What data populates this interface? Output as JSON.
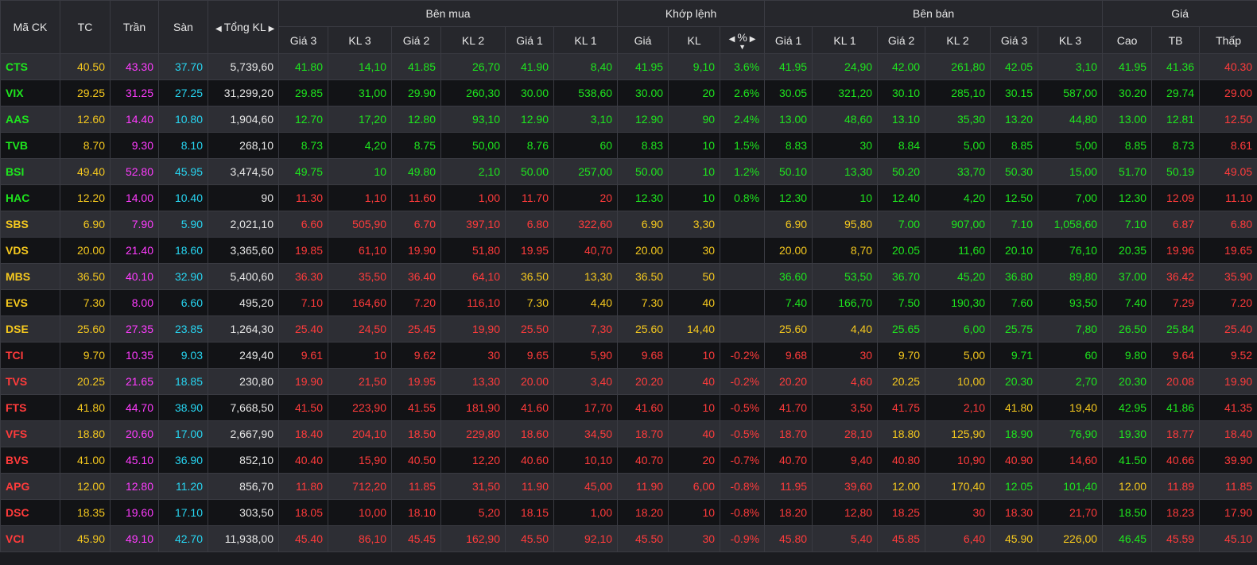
{
  "colors": {
    "up": "#1ee61e",
    "down": "#ff3b3b",
    "ref": "#f5c81e",
    "ceil": "#ff3cff",
    "floor": "#27d6f2",
    "white": "#e6e6e6"
  },
  "icons": {
    "left": "caret-left-icon",
    "right": "caret-right-icon",
    "sort": "sort-down-icon"
  },
  "header": {
    "symbol": "Mã CK",
    "ref": "TC",
    "ceil": "Trần",
    "floor": "Sàn",
    "total": "Tổng KL",
    "buy": "Bên mua",
    "match": "Khớp lệnh",
    "sell": "Bên bán",
    "price": "Giá",
    "buy_cols": [
      "Giá 3",
      "KL 3",
      "Giá 2",
      "KL 2",
      "Giá 1",
      "KL 1"
    ],
    "match_cols": [
      "Giá",
      "KL",
      "%"
    ],
    "sell_cols": [
      "Giá 1",
      "KL 1",
      "Giá 2",
      "KL 2",
      "Giá 3",
      "KL 3"
    ],
    "price_cols": [
      "Cao",
      "TB",
      "Thấp"
    ]
  },
  "rows": [
    {
      "sym": "CTS",
      "tc": "40.50",
      "tran": "43.30",
      "san": "37.70",
      "tkl": "5,739,60",
      "buy": [
        [
          "41.80",
          "14,10",
          "up"
        ],
        [
          "41.85",
          "26,70",
          "up"
        ],
        [
          "41.90",
          "8,40",
          "up"
        ]
      ],
      "match": [
        "41.95",
        "9,10",
        "3.6%",
        "up"
      ],
      "sell": [
        [
          "41.95",
          "24,90",
          "up"
        ],
        [
          "42.00",
          "261,80",
          "up"
        ],
        [
          "42.05",
          "3,10",
          "up"
        ]
      ],
      "hi": [
        "41.95",
        "up"
      ],
      "avg": [
        "41.36",
        "up"
      ],
      "lo": [
        "40.30",
        "down"
      ],
      "symc": "up"
    },
    {
      "sym": "VIX",
      "tc": "29.25",
      "tran": "31.25",
      "san": "27.25",
      "tkl": "31,299,20",
      "buy": [
        [
          "29.85",
          "31,00",
          "up"
        ],
        [
          "29.90",
          "260,30",
          "up"
        ],
        [
          "30.00",
          "538,60",
          "up"
        ]
      ],
      "match": [
        "30.00",
        "20",
        "2.6%",
        "up"
      ],
      "sell": [
        [
          "30.05",
          "321,20",
          "up"
        ],
        [
          "30.10",
          "285,10",
          "up"
        ],
        [
          "30.15",
          "587,00",
          "up"
        ]
      ],
      "hi": [
        "30.20",
        "up"
      ],
      "avg": [
        "29.74",
        "up"
      ],
      "lo": [
        "29.00",
        "down"
      ],
      "symc": "up"
    },
    {
      "sym": "AAS",
      "tc": "12.60",
      "tran": "14.40",
      "san": "10.80",
      "tkl": "1,904,60",
      "buy": [
        [
          "12.70",
          "17,20",
          "up"
        ],
        [
          "12.80",
          "93,10",
          "up"
        ],
        [
          "12.90",
          "3,10",
          "up"
        ]
      ],
      "match": [
        "12.90",
        "90",
        "2.4%",
        "up"
      ],
      "sell": [
        [
          "13.00",
          "48,60",
          "up"
        ],
        [
          "13.10",
          "35,30",
          "up"
        ],
        [
          "13.20",
          "44,80",
          "up"
        ]
      ],
      "hi": [
        "13.00",
        "up"
      ],
      "avg": [
        "12.81",
        "up"
      ],
      "lo": [
        "12.50",
        "down"
      ],
      "symc": "up"
    },
    {
      "sym": "TVB",
      "tc": "8.70",
      "tran": "9.30",
      "san": "8.10",
      "tkl": "268,10",
      "buy": [
        [
          "8.73",
          "4,20",
          "up"
        ],
        [
          "8.75",
          "50,00",
          "up"
        ],
        [
          "8.76",
          "60",
          "up"
        ]
      ],
      "match": [
        "8.83",
        "10",
        "1.5%",
        "up"
      ],
      "sell": [
        [
          "8.83",
          "30",
          "up"
        ],
        [
          "8.84",
          "5,00",
          "up"
        ],
        [
          "8.85",
          "5,00",
          "up"
        ]
      ],
      "hi": [
        "8.85",
        "up"
      ],
      "avg": [
        "8.73",
        "up"
      ],
      "lo": [
        "8.61",
        "down"
      ],
      "symc": "up"
    },
    {
      "sym": "BSI",
      "tc": "49.40",
      "tran": "52.80",
      "san": "45.95",
      "tkl": "3,474,50",
      "buy": [
        [
          "49.75",
          "10",
          "up"
        ],
        [
          "49.80",
          "2,10",
          "up"
        ],
        [
          "50.00",
          "257,00",
          "up"
        ]
      ],
      "match": [
        "50.00",
        "10",
        "1.2%",
        "up"
      ],
      "sell": [
        [
          "50.10",
          "13,30",
          "up"
        ],
        [
          "50.20",
          "33,70",
          "up"
        ],
        [
          "50.30",
          "15,00",
          "up"
        ]
      ],
      "hi": [
        "51.70",
        "up"
      ],
      "avg": [
        "50.19",
        "up"
      ],
      "lo": [
        "49.05",
        "down"
      ],
      "symc": "up"
    },
    {
      "sym": "HAC",
      "tc": "12.20",
      "tran": "14.00",
      "san": "10.40",
      "tkl": "90",
      "buy": [
        [
          "11.30",
          "1,10",
          "down"
        ],
        [
          "11.60",
          "1,00",
          "down"
        ],
        [
          "11.70",
          "20",
          "down"
        ]
      ],
      "match": [
        "12.30",
        "10",
        "0.8%",
        "up"
      ],
      "sell": [
        [
          "12.30",
          "10",
          "up"
        ],
        [
          "12.40",
          "4,20",
          "up"
        ],
        [
          "12.50",
          "7,00",
          "up"
        ]
      ],
      "hi": [
        "12.30",
        "up"
      ],
      "avg": [
        "12.09",
        "down"
      ],
      "lo": [
        "11.10",
        "down"
      ],
      "symc": "up"
    },
    {
      "sym": "SBS",
      "tc": "6.90",
      "tran": "7.90",
      "san": "5.90",
      "tkl": "2,021,10",
      "buy": [
        [
          "6.60",
          "505,90",
          "down"
        ],
        [
          "6.70",
          "397,10",
          "down"
        ],
        [
          "6.80",
          "322,60",
          "down"
        ]
      ],
      "match": [
        "6.90",
        "3,30",
        "",
        "ref"
      ],
      "sell": [
        [
          "6.90",
          "95,80",
          "ref"
        ],
        [
          "7.00",
          "907,00",
          "up"
        ],
        [
          "7.10",
          "1,058,60",
          "up"
        ]
      ],
      "hi": [
        "7.10",
        "up"
      ],
      "avg": [
        "6.87",
        "down"
      ],
      "lo": [
        "6.80",
        "down"
      ],
      "symc": "ref"
    },
    {
      "sym": "VDS",
      "tc": "20.00",
      "tran": "21.40",
      "san": "18.60",
      "tkl": "3,365,60",
      "buy": [
        [
          "19.85",
          "61,10",
          "down"
        ],
        [
          "19.90",
          "51,80",
          "down"
        ],
        [
          "19.95",
          "40,70",
          "down"
        ]
      ],
      "match": [
        "20.00",
        "30",
        "",
        "ref"
      ],
      "sell": [
        [
          "20.00",
          "8,70",
          "ref"
        ],
        [
          "20.05",
          "11,60",
          "up"
        ],
        [
          "20.10",
          "76,10",
          "up"
        ]
      ],
      "hi": [
        "20.35",
        "up"
      ],
      "avg": [
        "19.96",
        "down"
      ],
      "lo": [
        "19.65",
        "down"
      ],
      "symc": "ref"
    },
    {
      "sym": "MBS",
      "tc": "36.50",
      "tran": "40.10",
      "san": "32.90",
      "tkl": "5,400,60",
      "buy": [
        [
          "36.30",
          "35,50",
          "down"
        ],
        [
          "36.40",
          "64,10",
          "down"
        ],
        [
          "36.50",
          "13,30",
          "ref"
        ]
      ],
      "match": [
        "36.50",
        "50",
        "",
        "ref"
      ],
      "sell": [
        [
          "36.60",
          "53,50",
          "up"
        ],
        [
          "36.70",
          "45,20",
          "up"
        ],
        [
          "36.80",
          "89,80",
          "up"
        ]
      ],
      "hi": [
        "37.00",
        "up"
      ],
      "avg": [
        "36.42",
        "down"
      ],
      "lo": [
        "35.90",
        "down"
      ],
      "symc": "ref"
    },
    {
      "sym": "EVS",
      "tc": "7.30",
      "tran": "8.00",
      "san": "6.60",
      "tkl": "495,20",
      "buy": [
        [
          "7.10",
          "164,60",
          "down"
        ],
        [
          "7.20",
          "116,10",
          "down"
        ],
        [
          "7.30",
          "4,40",
          "ref"
        ]
      ],
      "match": [
        "7.30",
        "40",
        "",
        "ref"
      ],
      "sell": [
        [
          "7.40",
          "166,70",
          "up"
        ],
        [
          "7.50",
          "190,30",
          "up"
        ],
        [
          "7.60",
          "93,50",
          "up"
        ]
      ],
      "hi": [
        "7.40",
        "up"
      ],
      "avg": [
        "7.29",
        "down"
      ],
      "lo": [
        "7.20",
        "down"
      ],
      "symc": "ref"
    },
    {
      "sym": "DSE",
      "tc": "25.60",
      "tran": "27.35",
      "san": "23.85",
      "tkl": "1,264,30",
      "buy": [
        [
          "25.40",
          "24,50",
          "down"
        ],
        [
          "25.45",
          "19,90",
          "down"
        ],
        [
          "25.50",
          "7,30",
          "down"
        ]
      ],
      "match": [
        "25.60",
        "14,40",
        "",
        "ref"
      ],
      "sell": [
        [
          "25.60",
          "4,40",
          "ref"
        ],
        [
          "25.65",
          "6,00",
          "up"
        ],
        [
          "25.75",
          "7,80",
          "up"
        ]
      ],
      "hi": [
        "26.50",
        "up"
      ],
      "avg": [
        "25.84",
        "up"
      ],
      "lo": [
        "25.40",
        "down"
      ],
      "symc": "ref"
    },
    {
      "sym": "TCI",
      "tc": "9.70",
      "tran": "10.35",
      "san": "9.03",
      "tkl": "249,40",
      "buy": [
        [
          "9.61",
          "10",
          "down"
        ],
        [
          "9.62",
          "30",
          "down"
        ],
        [
          "9.65",
          "5,90",
          "down"
        ]
      ],
      "match": [
        "9.68",
        "10",
        "-0.2%",
        "down"
      ],
      "sell": [
        [
          "9.68",
          "30",
          "down"
        ],
        [
          "9.70",
          "5,00",
          "ref"
        ],
        [
          "9.71",
          "60",
          "up"
        ]
      ],
      "hi": [
        "9.80",
        "up"
      ],
      "avg": [
        "9.64",
        "down"
      ],
      "lo": [
        "9.52",
        "down"
      ],
      "symc": "down"
    },
    {
      "sym": "TVS",
      "tc": "20.25",
      "tran": "21.65",
      "san": "18.85",
      "tkl": "230,80",
      "buy": [
        [
          "19.90",
          "21,50",
          "down"
        ],
        [
          "19.95",
          "13,30",
          "down"
        ],
        [
          "20.00",
          "3,40",
          "down"
        ]
      ],
      "match": [
        "20.20",
        "40",
        "-0.2%",
        "down"
      ],
      "sell": [
        [
          "20.20",
          "4,60",
          "down"
        ],
        [
          "20.25",
          "10,00",
          "ref"
        ],
        [
          "20.30",
          "2,70",
          "up"
        ]
      ],
      "hi": [
        "20.30",
        "up"
      ],
      "avg": [
        "20.08",
        "down"
      ],
      "lo": [
        "19.90",
        "down"
      ],
      "symc": "down"
    },
    {
      "sym": "FTS",
      "tc": "41.80",
      "tran": "44.70",
      "san": "38.90",
      "tkl": "7,668,50",
      "buy": [
        [
          "41.50",
          "223,90",
          "down"
        ],
        [
          "41.55",
          "181,90",
          "down"
        ],
        [
          "41.60",
          "17,70",
          "down"
        ]
      ],
      "match": [
        "41.60",
        "10",
        "-0.5%",
        "down"
      ],
      "sell": [
        [
          "41.70",
          "3,50",
          "down"
        ],
        [
          "41.75",
          "2,10",
          "down"
        ],
        [
          "41.80",
          "19,40",
          "ref"
        ]
      ],
      "hi": [
        "42.95",
        "up"
      ],
      "avg": [
        "41.86",
        "up"
      ],
      "lo": [
        "41.35",
        "down"
      ],
      "symc": "down"
    },
    {
      "sym": "VFS",
      "tc": "18.80",
      "tran": "20.60",
      "san": "17.00",
      "tkl": "2,667,90",
      "buy": [
        [
          "18.40",
          "204,10",
          "down"
        ],
        [
          "18.50",
          "229,80",
          "down"
        ],
        [
          "18.60",
          "34,50",
          "down"
        ]
      ],
      "match": [
        "18.70",
        "40",
        "-0.5%",
        "down"
      ],
      "sell": [
        [
          "18.70",
          "28,10",
          "down"
        ],
        [
          "18.80",
          "125,90",
          "ref"
        ],
        [
          "18.90",
          "76,90",
          "up"
        ]
      ],
      "hi": [
        "19.30",
        "up"
      ],
      "avg": [
        "18.77",
        "down"
      ],
      "lo": [
        "18.40",
        "down"
      ],
      "symc": "down"
    },
    {
      "sym": "BVS",
      "tc": "41.00",
      "tran": "45.10",
      "san": "36.90",
      "tkl": "852,10",
      "buy": [
        [
          "40.40",
          "15,90",
          "down"
        ],
        [
          "40.50",
          "12,20",
          "down"
        ],
        [
          "40.60",
          "10,10",
          "down"
        ]
      ],
      "match": [
        "40.70",
        "20",
        "-0.7%",
        "down"
      ],
      "sell": [
        [
          "40.70",
          "9,40",
          "down"
        ],
        [
          "40.80",
          "10,90",
          "down"
        ],
        [
          "40.90",
          "14,60",
          "down"
        ]
      ],
      "hi": [
        "41.50",
        "up"
      ],
      "avg": [
        "40.66",
        "down"
      ],
      "lo": [
        "39.90",
        "down"
      ],
      "symc": "down"
    },
    {
      "sym": "APG",
      "tc": "12.00",
      "tran": "12.80",
      "san": "11.20",
      "tkl": "856,70",
      "buy": [
        [
          "11.80",
          "712,20",
          "down"
        ],
        [
          "11.85",
          "31,50",
          "down"
        ],
        [
          "11.90",
          "45,00",
          "down"
        ]
      ],
      "match": [
        "11.90",
        "6,00",
        "-0.8%",
        "down"
      ],
      "sell": [
        [
          "11.95",
          "39,60",
          "down"
        ],
        [
          "12.00",
          "170,40",
          "ref"
        ],
        [
          "12.05",
          "101,40",
          "up"
        ]
      ],
      "hi": [
        "12.00",
        "ref"
      ],
      "avg": [
        "11.89",
        "down"
      ],
      "lo": [
        "11.85",
        "down"
      ],
      "symc": "down"
    },
    {
      "sym": "DSC",
      "tc": "18.35",
      "tran": "19.60",
      "san": "17.10",
      "tkl": "303,50",
      "buy": [
        [
          "18.05",
          "10,00",
          "down"
        ],
        [
          "18.10",
          "5,20",
          "down"
        ],
        [
          "18.15",
          "1,00",
          "down"
        ]
      ],
      "match": [
        "18.20",
        "10",
        "-0.8%",
        "down"
      ],
      "sell": [
        [
          "18.20",
          "12,80",
          "down"
        ],
        [
          "18.25",
          "30",
          "down"
        ],
        [
          "18.30",
          "21,70",
          "down"
        ]
      ],
      "hi": [
        "18.50",
        "up"
      ],
      "avg": [
        "18.23",
        "down"
      ],
      "lo": [
        "17.90",
        "down"
      ],
      "symc": "down"
    },
    {
      "sym": "VCI",
      "tc": "45.90",
      "tran": "49.10",
      "san": "42.70",
      "tkl": "11,938,00",
      "buy": [
        [
          "45.40",
          "86,10",
          "down"
        ],
        [
          "45.45",
          "162,90",
          "down"
        ],
        [
          "45.50",
          "92,10",
          "down"
        ]
      ],
      "match": [
        "45.50",
        "30",
        "-0.9%",
        "down"
      ],
      "sell": [
        [
          "45.80",
          "5,40",
          "down"
        ],
        [
          "45.85",
          "6,40",
          "down"
        ],
        [
          "45.90",
          "226,00",
          "ref"
        ]
      ],
      "hi": [
        "46.45",
        "up"
      ],
      "avg": [
        "45.59",
        "down"
      ],
      "lo": [
        "45.10",
        "down"
      ],
      "symc": "down"
    }
  ]
}
